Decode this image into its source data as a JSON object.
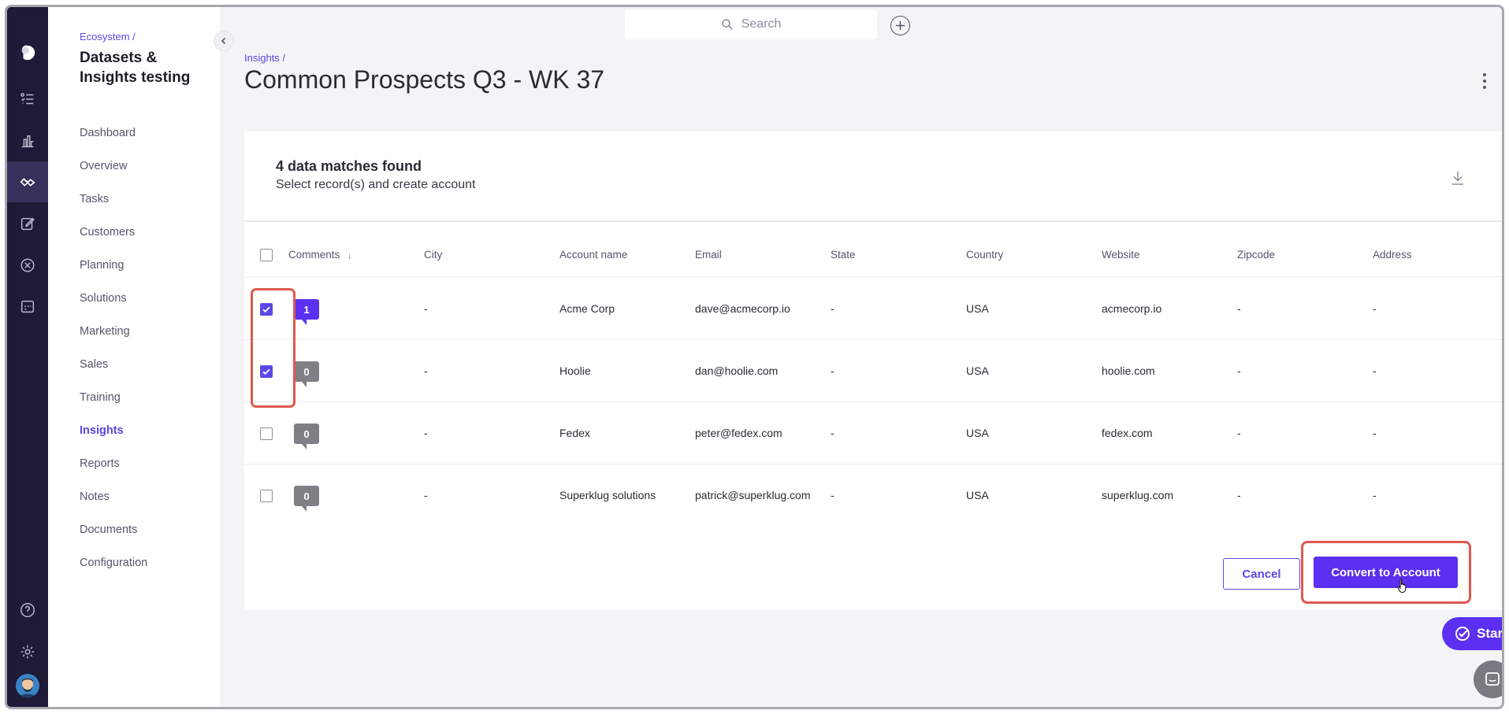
{
  "topbar": {
    "search_placeholder": "Search"
  },
  "sidebar": {
    "breadcrumb": "Ecosystem /",
    "workspace_title": "Datasets & Insights testing",
    "items": [
      {
        "label": "Dashboard"
      },
      {
        "label": "Overview"
      },
      {
        "label": "Tasks"
      },
      {
        "label": "Customers"
      },
      {
        "label": "Planning"
      },
      {
        "label": "Solutions"
      },
      {
        "label": "Marketing"
      },
      {
        "label": "Sales"
      },
      {
        "label": "Training"
      },
      {
        "label": "Insights",
        "active": true
      },
      {
        "label": "Reports"
      },
      {
        "label": "Notes"
      },
      {
        "label": "Documents"
      },
      {
        "label": "Configuration"
      }
    ]
  },
  "page": {
    "breadcrumb": "Insights /",
    "title": "Common Prospects Q3 - WK 37"
  },
  "card": {
    "heading": "4 data matches found",
    "subtext": "Select record(s) and create account"
  },
  "table": {
    "columns": [
      "Comments",
      "City",
      "Account name",
      "Email",
      "State",
      "Country",
      "Website",
      "Zipcode",
      "Address"
    ],
    "sort_indicator": "↓",
    "rows": [
      {
        "checked": true,
        "comments": "1",
        "city": "-",
        "account": "Acme Corp",
        "email": "dave@acmecorp.io",
        "state": "-",
        "country": "USA",
        "website": "acmecorp.io",
        "zipcode": "-",
        "address": "-"
      },
      {
        "checked": true,
        "comments": "0",
        "city": "-",
        "account": "Hoolie",
        "email": "dan@hoolie.com",
        "state": "-",
        "country": "USA",
        "website": "hoolie.com",
        "zipcode": "-",
        "address": "-"
      },
      {
        "checked": false,
        "comments": "0",
        "city": "-",
        "account": "Fedex",
        "email": "peter@fedex.com",
        "state": "-",
        "country": "USA",
        "website": "fedex.com",
        "zipcode": "-",
        "address": "-"
      },
      {
        "checked": false,
        "comments": "0",
        "city": "-",
        "account": "Superklug solutions",
        "email": "patrick@superklug.com",
        "state": "-",
        "country": "USA",
        "website": "superklug.com",
        "zipcode": "-",
        "address": "-"
      }
    ]
  },
  "actions": {
    "cancel_label": "Cancel",
    "convert_label": "Convert to Account",
    "start_label": "Start"
  },
  "colors": {
    "accent": "#5b30f0",
    "highlight": "#e0584f",
    "rail": "#1e1a37"
  }
}
